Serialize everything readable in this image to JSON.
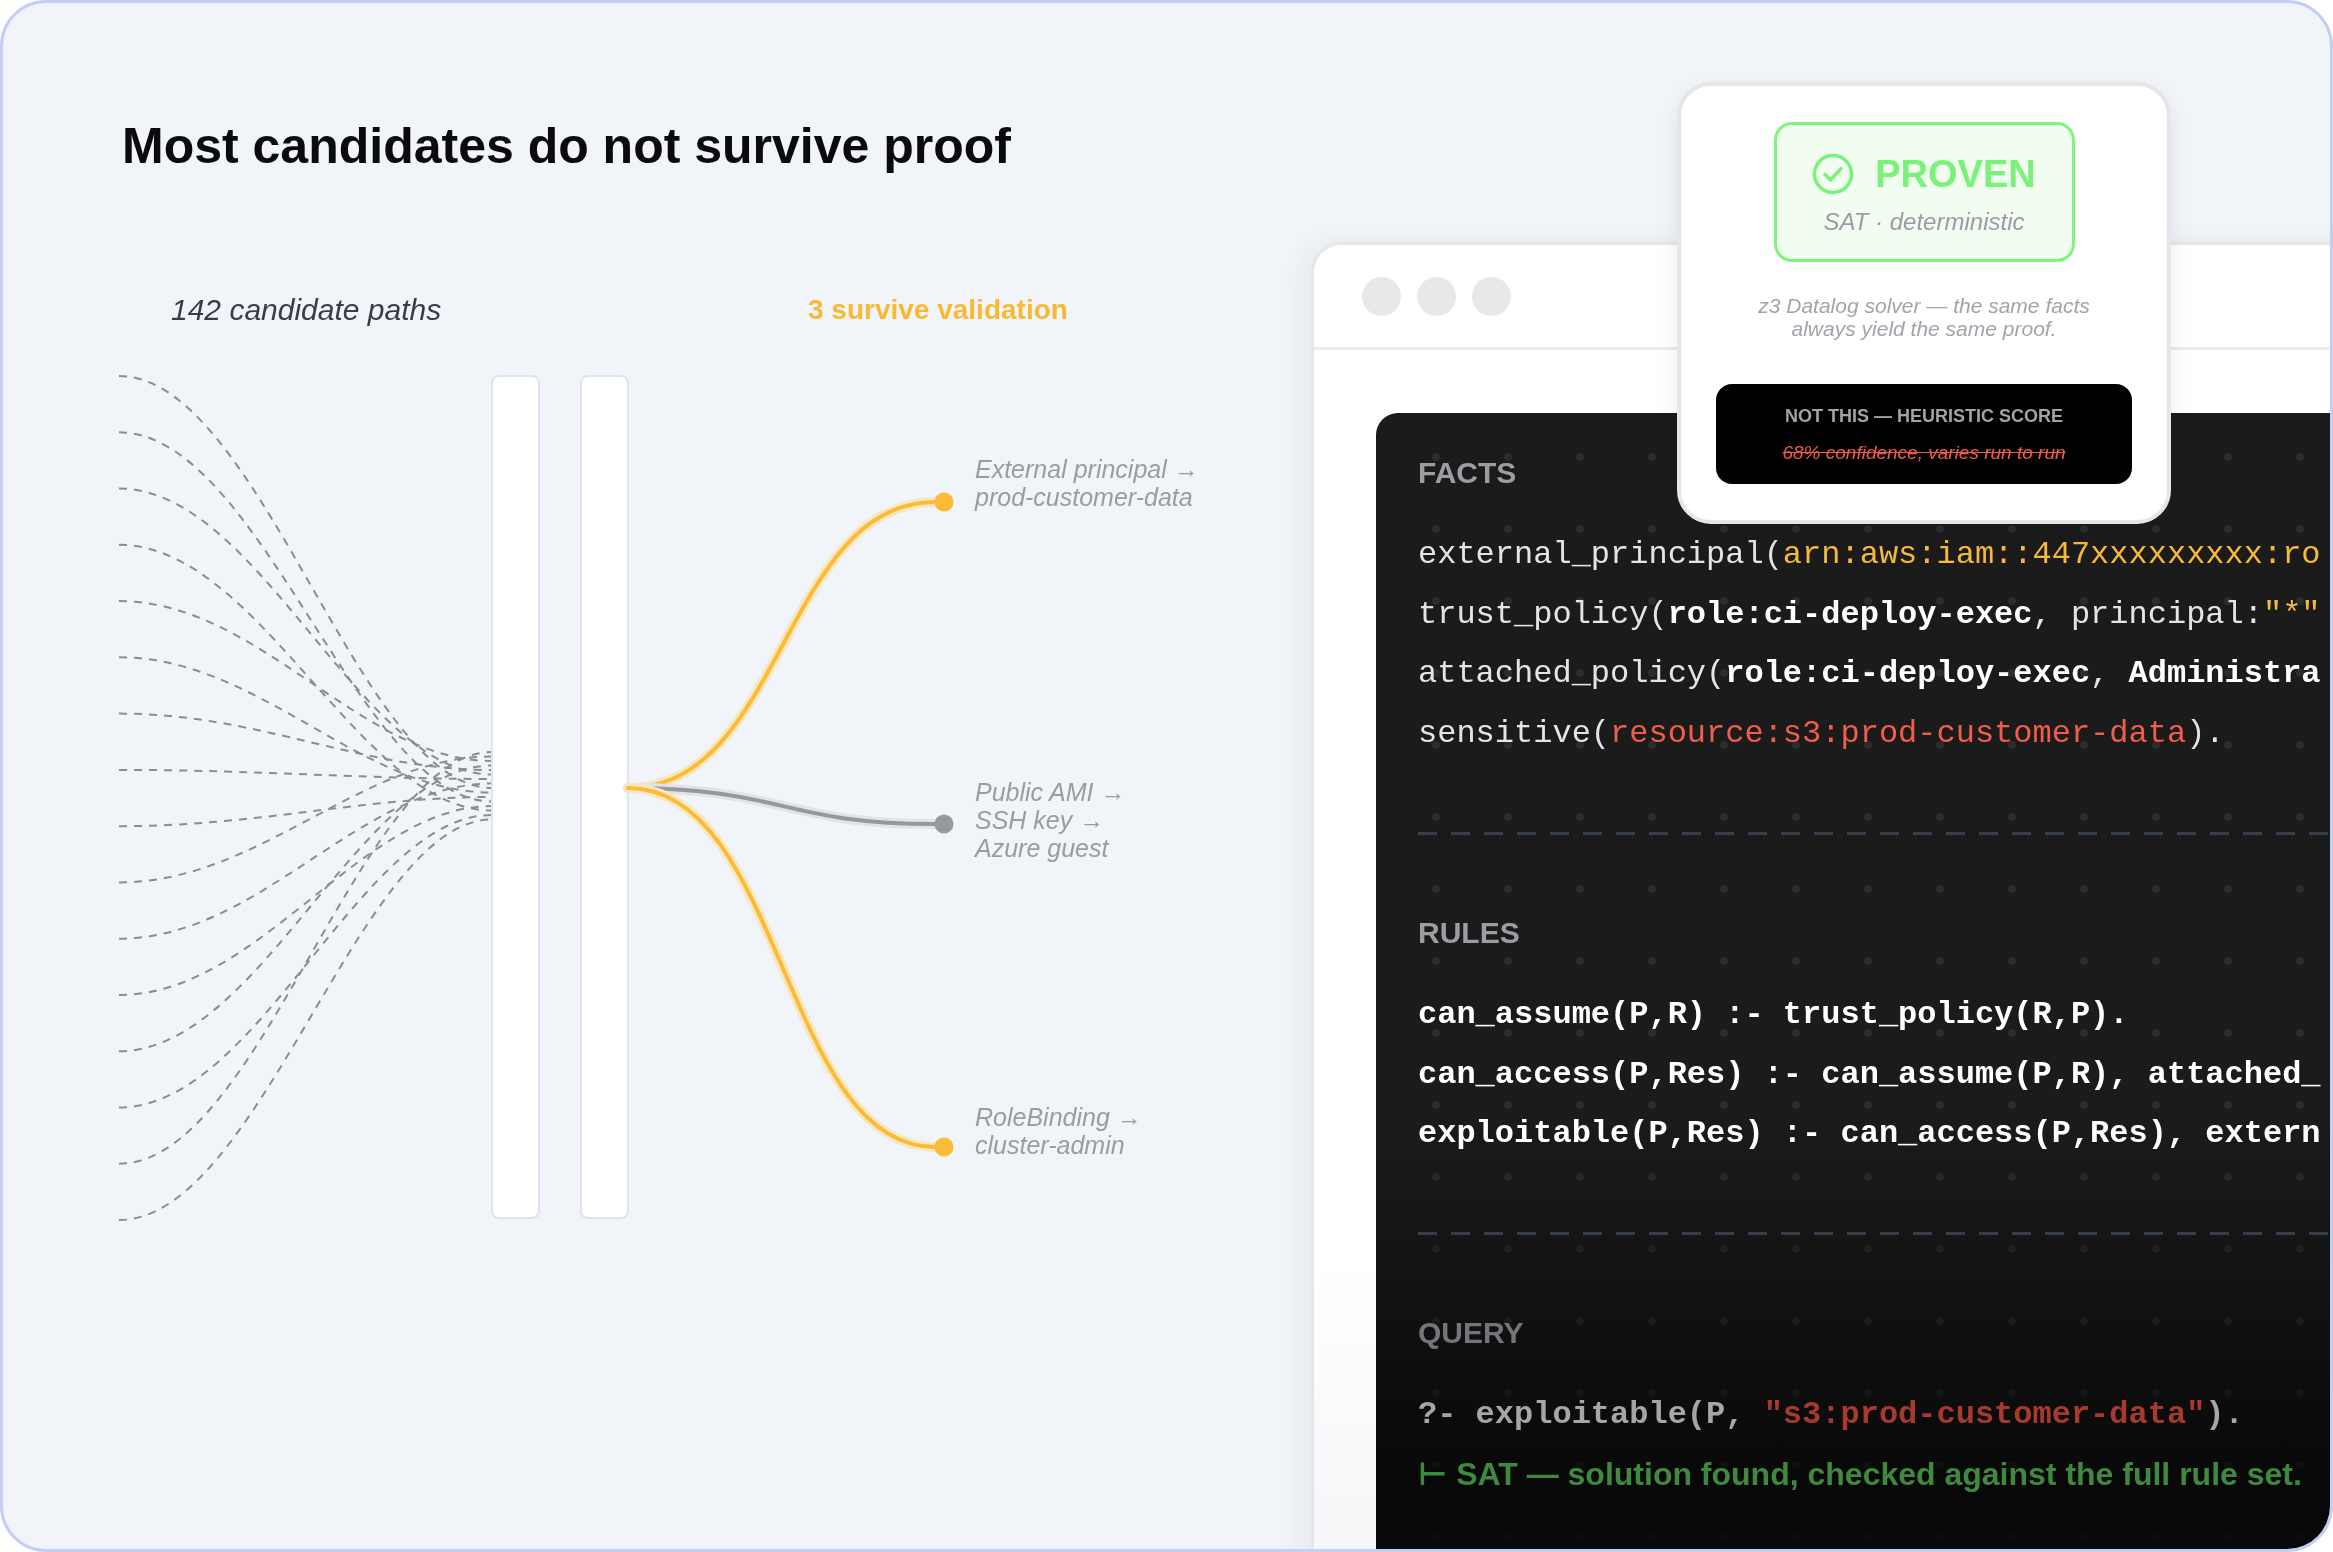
{
  "title": "Most candidates do not survive proof",
  "diagram": {
    "input_label": "142 candidate paths",
    "output_label": "3 survive validation",
    "paths": [
      {
        "label_lines": [
          "External principal →",
          "prod-customer-data"
        ],
        "survived": true
      },
      {
        "label_lines": [
          "Public AMI →",
          "SSH key →",
          "Azure guest"
        ],
        "survived": false
      },
      {
        "label_lines": [
          "RoleBinding →",
          "cluster-admin"
        ],
        "survived": true
      }
    ]
  },
  "verdict_card": {
    "badge": {
      "status": "PROVEN",
      "detail": "SAT · deterministic"
    },
    "description": "z3 Datalog solver — the same facts always yield the same proof.",
    "rejected": {
      "heading": "NOT THIS — HEURISTIC SCORE",
      "detail": "68% confidence, varies run to run"
    }
  },
  "code_window": {
    "sections": [
      {
        "heading": "FACTS",
        "lines": [
          {
            "kind": "code",
            "tokens": [
              {
                "text": "external_principal(",
                "kind": "plain"
              },
              {
                "text": "arn:aws:iam::447xxxxxxxxx:ro",
                "kind": "literal"
              }
            ]
          },
          {
            "kind": "code",
            "tokens": [
              {
                "text": "trust_policy(",
                "kind": "plain"
              },
              {
                "text": "role:ci-deploy-exec",
                "kind": "strong"
              },
              {
                "text": ", principal:",
                "kind": "plain"
              },
              {
                "text": "\"*\"",
                "kind": "literal"
              }
            ]
          },
          {
            "kind": "code",
            "tokens": [
              {
                "text": "attached_policy(",
                "kind": "plain"
              },
              {
                "text": "role:ci-deploy-exec",
                "kind": "strong"
              },
              {
                "text": ", ",
                "kind": "plain"
              },
              {
                "text": "Administra",
                "kind": "strong"
              }
            ]
          },
          {
            "kind": "code",
            "tokens": [
              {
                "text": "sensitive(",
                "kind": "plain"
              },
              {
                "text": "resource:s3:prod-customer-data",
                "kind": "resource"
              },
              {
                "text": ").",
                "kind": "plain"
              }
            ]
          }
        ]
      },
      {
        "heading": "RULES",
        "lines": [
          {
            "kind": "code",
            "tokens": [
              {
                "text": "can_assume(P,R) :- trust_policy(R,P).",
                "kind": "strong"
              }
            ]
          },
          {
            "kind": "code",
            "tokens": [
              {
                "text": "can_access(P,Res) :- can_assume(P,R), attached_",
                "kind": "strong"
              }
            ]
          },
          {
            "kind": "code",
            "tokens": [
              {
                "text": "exploitable(P,Res) :- can_access(P,Res), extern",
                "kind": "strong"
              }
            ]
          }
        ]
      },
      {
        "heading": "QUERY",
        "lines": [
          {
            "kind": "code",
            "tokens": [
              {
                "text": "?- exploitable(P, ",
                "kind": "strong"
              },
              {
                "text": "\"s3:prod-customer-data\"",
                "kind": "strong_resource"
              },
              {
                "text": ").",
                "kind": "strong"
              }
            ]
          },
          {
            "kind": "result",
            "tokens": [
              {
                "text": "⊢ SAT — solution found, checked against the full rule set.",
                "kind": "success"
              }
            ]
          }
        ]
      }
    ]
  }
}
